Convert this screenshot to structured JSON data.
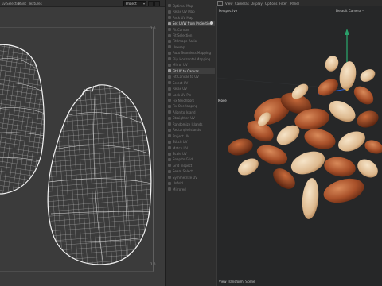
{
  "uv_editor": {
    "menu": [
      {
        "label": "uv Selection"
      },
      {
        "label": "Paint"
      },
      {
        "label": "Textures"
      }
    ],
    "projection_value": "Project",
    "corner_top": "1.0",
    "corner_bottom": "1.0"
  },
  "tool_panel": {
    "items": [
      {
        "label": "Optimal Map",
        "state": "dim"
      },
      {
        "label": "Relax UV Map",
        "state": "dim"
      },
      {
        "label": "Pack UV Map",
        "state": "dim"
      },
      {
        "label": "Set UVW from Projection",
        "state": "bright"
      },
      {
        "label": "Fit Canvas",
        "state": "dim"
      },
      {
        "label": "Fit Selection",
        "state": "dim"
      },
      {
        "label": "Fit Image Ratio",
        "state": "dim"
      },
      {
        "label": "Unwrap",
        "state": "dim"
      },
      {
        "label": "Auto Seamless Mapping",
        "state": "dim"
      },
      {
        "label": "Flip Horizontal Mapping",
        "state": "dim"
      },
      {
        "label": "Mirror UV",
        "state": "dim"
      },
      {
        "label": "Fit UV to Canvas",
        "state": "bright"
      },
      {
        "label": "Fit Canvas to UV",
        "state": "dim"
      },
      {
        "label": "Select UV",
        "state": "dim"
      },
      {
        "label": "Relax UV",
        "state": "dim"
      },
      {
        "label": "Lock UV Pin",
        "state": "dim"
      },
      {
        "label": "Fix Neighbors",
        "state": "dim"
      },
      {
        "label": "Fix Overlapping",
        "state": "dim"
      },
      {
        "label": "Align to Island",
        "state": "dim"
      },
      {
        "label": "Straighten UV",
        "state": "dim"
      },
      {
        "label": "Randomize Islands",
        "state": "dim"
      },
      {
        "label": "Rectangle Islands",
        "state": "dim"
      },
      {
        "label": "Project UV",
        "state": "dim"
      },
      {
        "label": "Stitch UV",
        "state": "dim"
      },
      {
        "label": "Match UV",
        "state": "dim"
      },
      {
        "label": "Scale UV",
        "state": "dim"
      },
      {
        "label": "Snap to Grid",
        "state": "dim"
      },
      {
        "label": "Grid Inspect",
        "state": "dim"
      },
      {
        "label": "Seam Select",
        "state": "dim"
      },
      {
        "label": "Symmetrize UV",
        "state": "dim"
      },
      {
        "label": "Unfold",
        "state": "dim"
      },
      {
        "label": "Mirrored",
        "state": "dim"
      }
    ]
  },
  "viewport": {
    "menu": [
      {
        "label": "View"
      },
      {
        "label": "Cameras"
      },
      {
        "label": "Display"
      },
      {
        "label": "Options"
      },
      {
        "label": "Filter"
      },
      {
        "label": "Panel"
      }
    ],
    "perspective_label": "Perspective",
    "camera_label": "Default Camera →",
    "move_label": "Move",
    "footer": "View Transform: Scene"
  },
  "colors": {
    "uv_wire": "#e8e8e8",
    "nut_shell": "#b35a2c",
    "nut_flesh": "#e6c9a3",
    "viewport_bg": "#262728"
  }
}
